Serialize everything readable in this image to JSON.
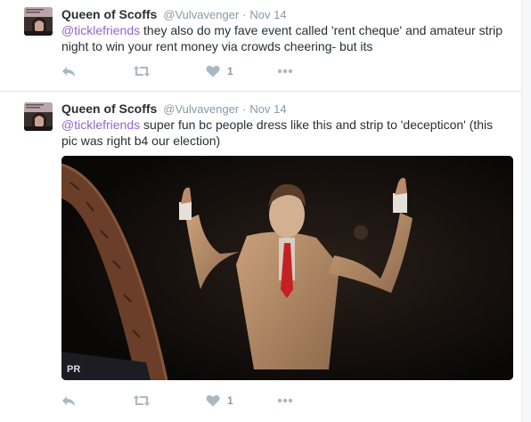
{
  "tweets": [
    {
      "name": "Queen of Scoffs",
      "handle": "@Vulvavenger",
      "separator": "·",
      "time": "Nov 14",
      "mention": "@ticklefriends",
      "text": " they also do my fave event called 'rent cheque' and amateur strip night to win your rent money via crowds cheering- but its",
      "like_count": "1",
      "icons": {
        "reply": "reply-icon",
        "retweet": "retweet-icon",
        "like": "heart-icon",
        "more": "more-icon"
      }
    },
    {
      "name": "Queen of Scoffs",
      "handle": "@Vulvavenger",
      "separator": "·",
      "time": "Nov 14",
      "mention": "@ticklefriends",
      "text": " super fun bc people dress like this and strip to 'decepticon' (this pic was right b4 our election)",
      "like_count": "1",
      "icons": {
        "reply": "reply-icon",
        "retweet": "retweet-icon",
        "like": "heart-icon",
        "more": "more-icon"
      }
    }
  ],
  "colors": {
    "mention": "#9266cc",
    "meta": "#8899a6",
    "icon": "#aab8c2",
    "text": "#292f33"
  }
}
